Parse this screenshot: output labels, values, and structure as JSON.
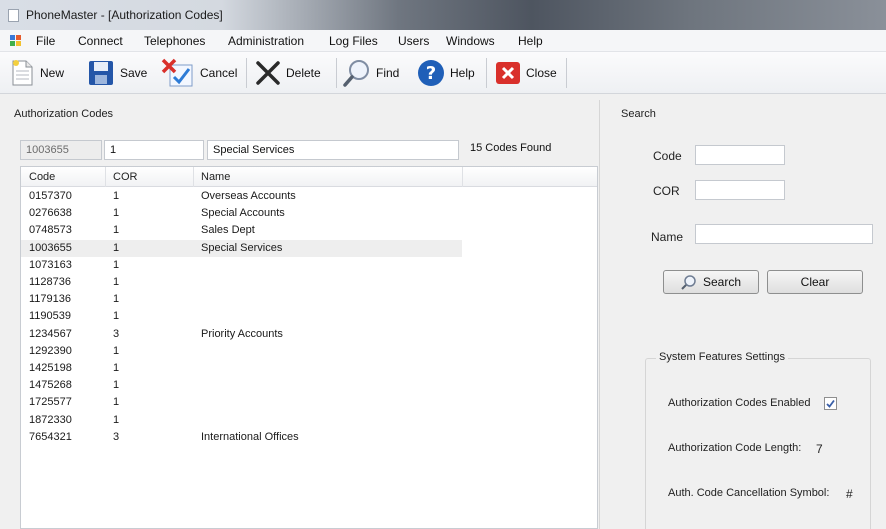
{
  "window": {
    "title": "PhoneMaster - [Authorization Codes]"
  },
  "menu": [
    "File",
    "Connect",
    "Telephones",
    "Administration",
    "Log Files",
    "Users",
    "Windows",
    "Help"
  ],
  "toolbar": {
    "new_label": "New",
    "save_label": "Save",
    "cancel_label": "Cancel",
    "delete_label": "Delete",
    "find_label": "Find",
    "help_label": "Help",
    "close_label": "Close"
  },
  "auth": {
    "section_title": "Authorization Codes",
    "edit_code": "1003655",
    "edit_cor": "1",
    "edit_name": "Special Services",
    "found_text": "15 Codes Found",
    "columns": [
      "Code",
      "COR",
      "Name"
    ],
    "rows": [
      {
        "code": "0157370",
        "cor": "1",
        "name": "Overseas Accounts"
      },
      {
        "code": "0276638",
        "cor": "1",
        "name": "Special Accounts"
      },
      {
        "code": "0748573",
        "cor": "1",
        "name": "Sales Dept"
      },
      {
        "code": "1003655",
        "cor": "1",
        "name": "Special Services"
      },
      {
        "code": "1073163",
        "cor": "1",
        "name": ""
      },
      {
        "code": "1128736",
        "cor": "1",
        "name": ""
      },
      {
        "code": "1179136",
        "cor": "1",
        "name": ""
      },
      {
        "code": "1190539",
        "cor": "1",
        "name": ""
      },
      {
        "code": "1234567",
        "cor": "3",
        "name": "Priority Accounts"
      },
      {
        "code": "1292390",
        "cor": "1",
        "name": ""
      },
      {
        "code": "1425198",
        "cor": "1",
        "name": ""
      },
      {
        "code": "1475268",
        "cor": "1",
        "name": ""
      },
      {
        "code": "1725577",
        "cor": "1",
        "name": ""
      },
      {
        "code": "1872330",
        "cor": "1",
        "name": ""
      },
      {
        "code": "7654321",
        "cor": "3",
        "name": "International Offices"
      }
    ],
    "selected_row": 3
  },
  "search": {
    "title": "Search",
    "code_label": "Code",
    "cor_label": "COR",
    "name_label": "Name",
    "code_value": "",
    "cor_value": "",
    "name_value": "",
    "search_button": "Search",
    "clear_button": "Clear"
  },
  "features": {
    "title": "System Features Settings",
    "enabled_label": "Authorization Codes Enabled",
    "enabled_checked": true,
    "length_label": "Authorization Code Length:",
    "length_value": "7",
    "cancel_symbol_label": "Auth. Code Cancellation Symbol:",
    "cancel_symbol_value": "#"
  },
  "colors": {
    "accent_blue": "#1f5fb8",
    "close_red": "#d9302b",
    "selected_row": "#eeeeee"
  }
}
